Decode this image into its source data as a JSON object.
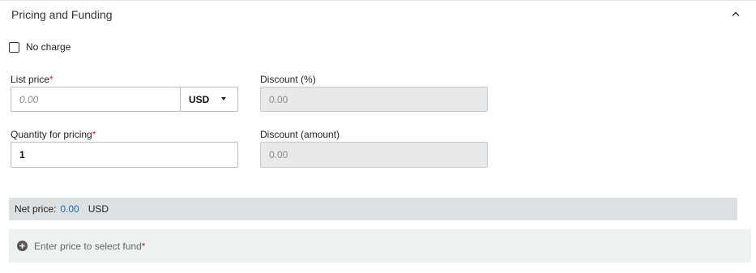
{
  "section": {
    "title": "Pricing and Funding",
    "toggle_icon": "chevron-up-icon"
  },
  "no_charge": {
    "label": "No charge",
    "checked": false
  },
  "list_price": {
    "label": "List price",
    "required_mark": "*",
    "placeholder": "0.00",
    "currency": "USD"
  },
  "discount_percent": {
    "label": "Discount (%)",
    "value": "0.00"
  },
  "quantity": {
    "label": "Quantity for pricing",
    "required_mark": "*",
    "value": "1"
  },
  "discount_amount": {
    "label": "Discount (amount)",
    "value": "0.00"
  },
  "net_price": {
    "label": "Net price:",
    "value": "0.00",
    "currency": "USD"
  },
  "fund": {
    "text": "Enter price to select fund",
    "required_mark": "*",
    "icon": "plus-circle-icon"
  },
  "colors": {
    "required": "#c62828",
    "net_value": "#1c6bb5",
    "disabled_bg": "#e7e9eb"
  }
}
